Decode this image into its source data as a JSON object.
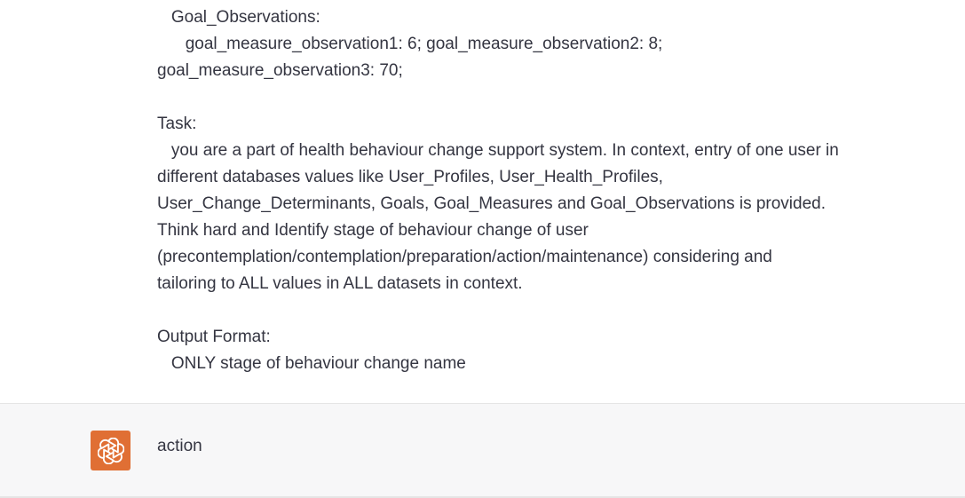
{
  "conversation": {
    "user_message": {
      "lines": [
        "   Goal_Observations:",
        "      goal_measure_observation1: 6; goal_measure_observation2: 8;",
        "goal_measure_observation3: 70;",
        "",
        "Task:",
        "   you are a part of health behaviour change support system. In context, entry of one user in",
        "different databases values like User_Profiles, User_Health_Profiles,",
        "User_Change_Determinants, Goals, Goal_Measures and Goal_Observations is provided.",
        "Think hard and Identify stage of behaviour change of user",
        "(precontemplation/contemplation/preparation/action/maintenance) considering and",
        "tailoring to ALL values in ALL datasets in context.",
        "",
        "Output Format:",
        "   ONLY stage of behaviour change name"
      ]
    },
    "assistant_message": {
      "avatar_icon": "openai-logo-icon",
      "avatar_color": "#e06f34",
      "text": "action"
    }
  }
}
